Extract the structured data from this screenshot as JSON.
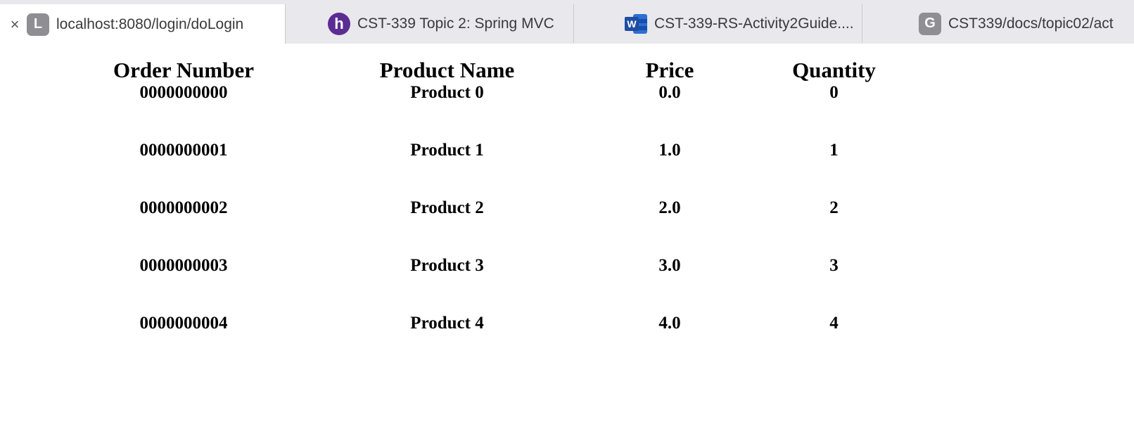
{
  "tabs": [
    {
      "title": "localhost:8080/login/doLogin",
      "favicon": "L",
      "close": "×"
    },
    {
      "title": "CST-339 Topic 2: Spring MVC",
      "favicon": "h"
    },
    {
      "title": "CST-339-RS-Activity2Guide....",
      "favicon": "W"
    },
    {
      "title": "CST339/docs/topic02/act",
      "favicon": "G"
    }
  ],
  "table": {
    "headers": [
      "Order Number",
      "Product Name",
      "Price",
      "Quantity"
    ],
    "rows": [
      [
        "0000000000",
        "Product 0",
        "0.0",
        "0"
      ],
      [
        "0000000001",
        "Product 1",
        "1.0",
        "1"
      ],
      [
        "0000000002",
        "Product 2",
        "2.0",
        "2"
      ],
      [
        "0000000003",
        "Product 3",
        "3.0",
        "3"
      ],
      [
        "0000000004",
        "Product 4",
        "4.0",
        "4"
      ]
    ]
  },
  "colors": {
    "tabbar_bg": "#e8e8ed",
    "active_tab_bg": "#ffffff",
    "hcu_purple": "#5b2c91",
    "word_blue": "#2b6fd6"
  }
}
